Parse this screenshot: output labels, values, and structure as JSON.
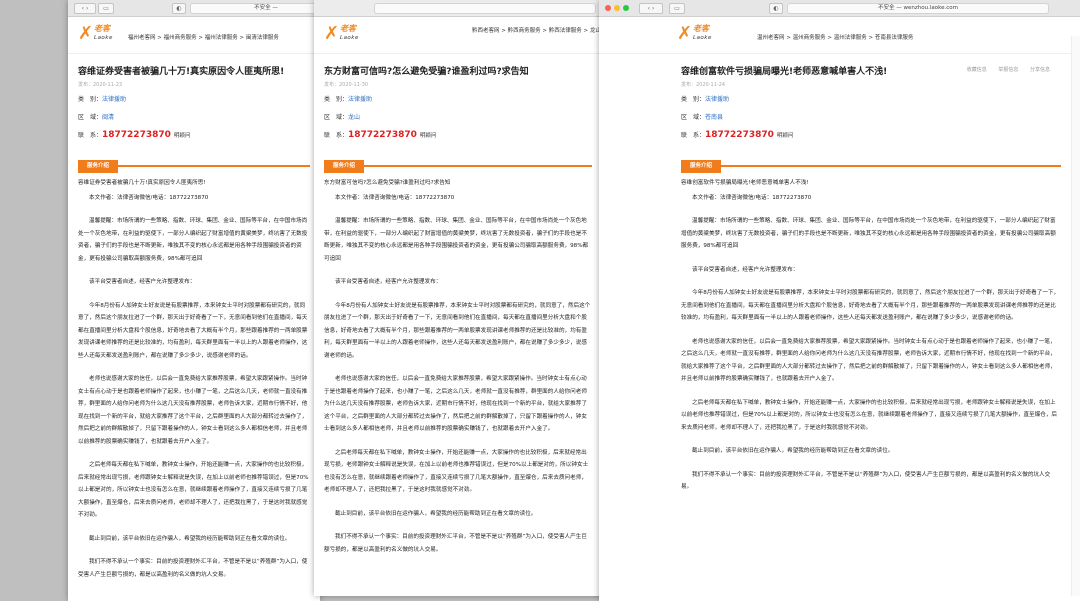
{
  "windows": [
    {
      "id": "w1",
      "browser": {
        "address": "不安全 — "
      },
      "site": {
        "logo_cn": "老客",
        "logo_en": "Laoke",
        "breadcrumb": "福州老客网 > 福州商务服务 > 福州法律服务 > 闽清法律服务"
      },
      "title": "容维证券受害者被骗几十万!真实原因令人匪夷所思!",
      "date": "发布：2020-11-23",
      "meta": {
        "category_label": "类　别：",
        "category": "法律援助",
        "region_label": "区　域：",
        "region": "闽清",
        "contact_label": "联　系：",
        "phone": "18772273870",
        "contact_name": "明颖问"
      },
      "service_label": "服务介绍",
      "paragraphs": [
        "容维证券受害者被骗几十万!真实原因令人匪夷所思!",
        "本文作者：法律咨询微信/电话：18772273870",
        "温馨提醒：市场所谓的一些策略、指数、环球、集团、金业、国际等平台，在中国市场尚处一个灰色地带，在利益的驱使下，一部分人编织起了财富增值的黄粱美梦，终坑害了无数投资者，骗子们的手段也是不断更新，唯独其不变的核心永远都是用各种手段围骗投资者的资金，更有投骗公司骗取高额服务费，98%都可追回",
        "该平台受害者自述，经客户允许整理发布：",
        "今年8月份有人加钟女士好友说是有股票推荐，本来钟女士平时对股票都有研究的，就同意了，然后这个朋友拉进了一个群，那天出于好奇看了一下，无意间看到他们在直播间，每天都在直播间里分析大盘和个股信息，好奇地去看了大概有半个月，那些跟着推荐的一两单股票发现讲课老师推荐的还是比较准的，均有盈利，每天群里面有一半以上的人跟着老师操作，这些人还每天都发送盈利账户，都在说赚了多少多少，说感谢老师的话。",
        "老师也说感谢大家的信任，以后会一直免费给大家推荐股票，希望大家跟紧操作。当时钟女士有点心动于是也跟着老师操作了起来，也小赚了一笔，之后这么几天，老师就一直没有推荐，群里面的人给你问老师为什么这几天没有推荐股票，老师告诉大家，近期市行情不好，他现在找到一个新的平台，就给大家推荐了这个平台，之后群里面的人大部分都转过去操作了，然后把之前的群解散掉了，只留下跟着操作的人，钟女士看到这么多人都相信老师，并且老师以前推荐的股票确实赚钱了，也就跟着去开户入金了。",
        "之后老师每天都在私下喊单，教钟女士操作，开始还能赚一点，大家操作的也比较积极，后来就经常出现亏损，老师跟钟女士解释说是失误，在加上以前老师也推荐错误过，但是70%以上都是对的，所以钟女士也没有怎么在意，就继续跟着老师操作了，直接又连续亏损了几笔大额操作，直至爆仓，后来去质问老师，老师却不理人了，还把我拉黑了，于是这时我就感觉不对劲。",
        "截止到目前，该平台依旧在运作骗人，希望我的经历能帮助到正在看文章的读位。",
        "我们不得不承认一个事实：目前的投资理财外汇平台，不管是不是以“养殖群”为入口，使受害人产生巨额亏损的，都是以高盈利的名义做的坑人交易。"
      ]
    },
    {
      "id": "w2",
      "browser": {
        "address": ""
      },
      "site": {
        "logo_cn": "老客",
        "logo_en": "Laoke",
        "breadcrumb": "黔西老客网 > 黔西商务服务 > 黔西法律服务 > 龙山"
      },
      "title": "东方财富可信吗?怎么避免受骗?谁盈利过吗?求告知",
      "date": "发布：2020-11-30",
      "meta": {
        "category_label": "类　别：",
        "category": "法律援助",
        "region_label": "区　域：",
        "region": "龙山",
        "contact_label": "联　系：",
        "phone": "18772273870",
        "contact_name": "明颖问"
      },
      "service_label": "服务介绍",
      "paragraphs": [
        "东方财富可信吗?怎么避免受骗?谁盈利过吗?求告知",
        "本文作者：法律咨询微信/电话：18772273870",
        "温馨提醒：市场所谓的一些策略、指数、环球、集团、金业、国际等平台，在中国市场尚处一个灰色地带，在利益的驱使下，一部分人编织起了财富增值的黄粱美梦，终坑害了无数投资者，骗子们的手段也是不断更新，唯独其不变的核心永远都是用各种手段围骗投资者的资金，更有投骗公司骗取高额服务费，98%都可追回",
        "该平台受害者自述，经客户允许整理发布：",
        "今年8月份有人加钟女士好友说是有股票推荐，本来钟女士平时对股票都有研究的，就同意了，然后这个朋友拉进了一个群，那天出于好奇看了一下，无意间看到他们在直播间，每天都在直播间里分析大盘和个股信息，好奇地去看了大概有半个月，那些跟着推荐的一两单股票发现讲课老师推荐的还是比较准的，均有盈利，每天群里面有一半以上的人跟着老师操作，这些人还每天都发送盈利账户，都在说赚了多少多少，说感谢老师的话。",
        "老师也说感谢大家的信任，以后会一直免费给大家推荐股票，希望大家跟紧操作。当时钟女士有点心动于是也跟着老师操作了起来，也小赚了一笔，之后这么几天，老师就一直没有推荐，群里面的人给你问老师为什么这几天没有推荐股票，老师告诉大家，近期市行情不好，他现在找到一个新的平台，就给大家推荐了这个平台，之后群里面的人大部分都转过去操作了，然后把之前的群解散掉了，只留下跟着操作的人，钟女士看到这么多人都相信老师，并且老师以前推荐的股票确实赚钱了，也就跟着去开户入金了。",
        "之后老师每天都在私下喊单，教钟女士操作，开始还能赚一点，大家操作的也比较积极，后来就经常出现亏损，老师跟钟女士解释说是失误，在加上以前老师也推荐错误过，但是70%以上都是对的，所以钟女士也没有怎么在意，就继续跟着老师操作了，直接又连续亏损了几笔大额操作，直至爆仓，后来去质问老师，老师却不理人了，还把我拉黑了，于是这时我就感觉不对劲。",
        "截止到目前，该平台依旧在运作骗人，希望我的经历能帮助到正在看文章的读位。",
        "我们不得不承认一个事实：目前的投资理财外汇平台，不管是不是以“养殖群”为入口，使受害人产生巨额亏损的，都是以高盈利的名义做的坑人交易。"
      ]
    },
    {
      "id": "w3",
      "browser": {
        "address": "不安全 — wenzhou.laoke.com"
      },
      "site": {
        "logo_cn": "老客",
        "logo_en": "Laoke",
        "breadcrumb": "温州老客网 > 温州商务服务 > 温州法律服务 > 苍南县法律服务"
      },
      "title": "容维创富软件亏损骗局曝光!老师恶意喊单害人不浅!",
      "date": "发布：2020-11-24",
      "right_meta": [
        "收藏信息",
        "举报信息",
        "分享信息"
      ],
      "meta": {
        "category_label": "类　别：",
        "category": "法律援助",
        "region_label": "区　域：",
        "region": "苍南县",
        "contact_label": "联　系：",
        "phone": "18772273870",
        "contact_name": "明颖问"
      },
      "service_label": "服务介绍",
      "paragraphs": [
        "容维创富软件亏损骗局曝光!老师恶意喊单害人不浅!",
        "本文作者：法律咨询微信/电话：18772273870",
        "温馨提醒：市场所谓的一些策略、指数、环球、集团、金业、国际等平台，在中国市场尚处一个灰色地带，在利益的驱使下，一部分人编织起了财富增值的黄粱美梦，终坑害了无数投资者，骗子们的手段也是不断更新，唯独其不变的核心永远都是用各种手段围骗投资者的资金，更有投骗公司骗取高额服务费，98%都可追回",
        "该平台受害者自述，经客户允许整理发布：",
        "今年8月份有人加钟女士好友说是有股票推荐，本来钟女士平时对股票都有研究的，就同意了，然后这个朋友拉进了一个群，那天出于好奇看了一下，无意间看到他们在直播间，每天都在直播间里分析大盘和个股信息，好奇地去看了大概有半个月，那些跟着推荐的一两单股票发现讲课老师推荐的还是比较准的，均有盈利，每天群里面有一半以上的人跟着老师操作，这些人还每天都发送盈利账户，都在说赚了多少多少，说感谢老师的话。",
        "老师也说感谢大家的信任，以后会一直免费给大家推荐股票，希望大家跟紧操作。当时钟女士有点心动于是也跟着老师操作了起来，也小赚了一笔，之后这么几天，老师就一直没有推荐，群里面的人给你问老师为什么这几天没有推荐股票，老师告诉大家，近期市行情不好，他现在找到一个新的平台，就给大家推荐了这个平台，之后群里面的人大部分都转过去操作了，然后把之前的群解散掉了，只留下跟着操作的人，钟女士看到这么多人都相信老师，并且老师以前推荐的股票确实赚钱了，也就跟着去开户入金了。",
        "之后老师每天都在私下喊单，教钟女士操作，开始还能赚一点，大家操作的也比较积极，后来就经常出现亏损，老师跟钟女士解释说是失误，在加上以前老师也推荐错误过，但是70%以上都是对的，所以钟女士也没有怎么在意，就继续跟着老师操作了，直接又连续亏损了几笔大额操作，直至爆仓，后来去质问老师，老师却不理人了，还把我拉黑了，于是这时我就感觉不对劲。",
        "截止到目前，该平台依旧在运作骗人，希望我的经历能帮助到正在看文章的读位。",
        "我们不得不承认一个事实：目前的投资理财外汇平台，不管是不是以“养殖群”为入口，使受害人产生巨额亏损的，都是以高盈利的名义做的坑人交易。"
      ]
    }
  ],
  "colors": {
    "accent": "#f07c1c",
    "phone": "#e02020",
    "link": "#2a6cc4"
  }
}
